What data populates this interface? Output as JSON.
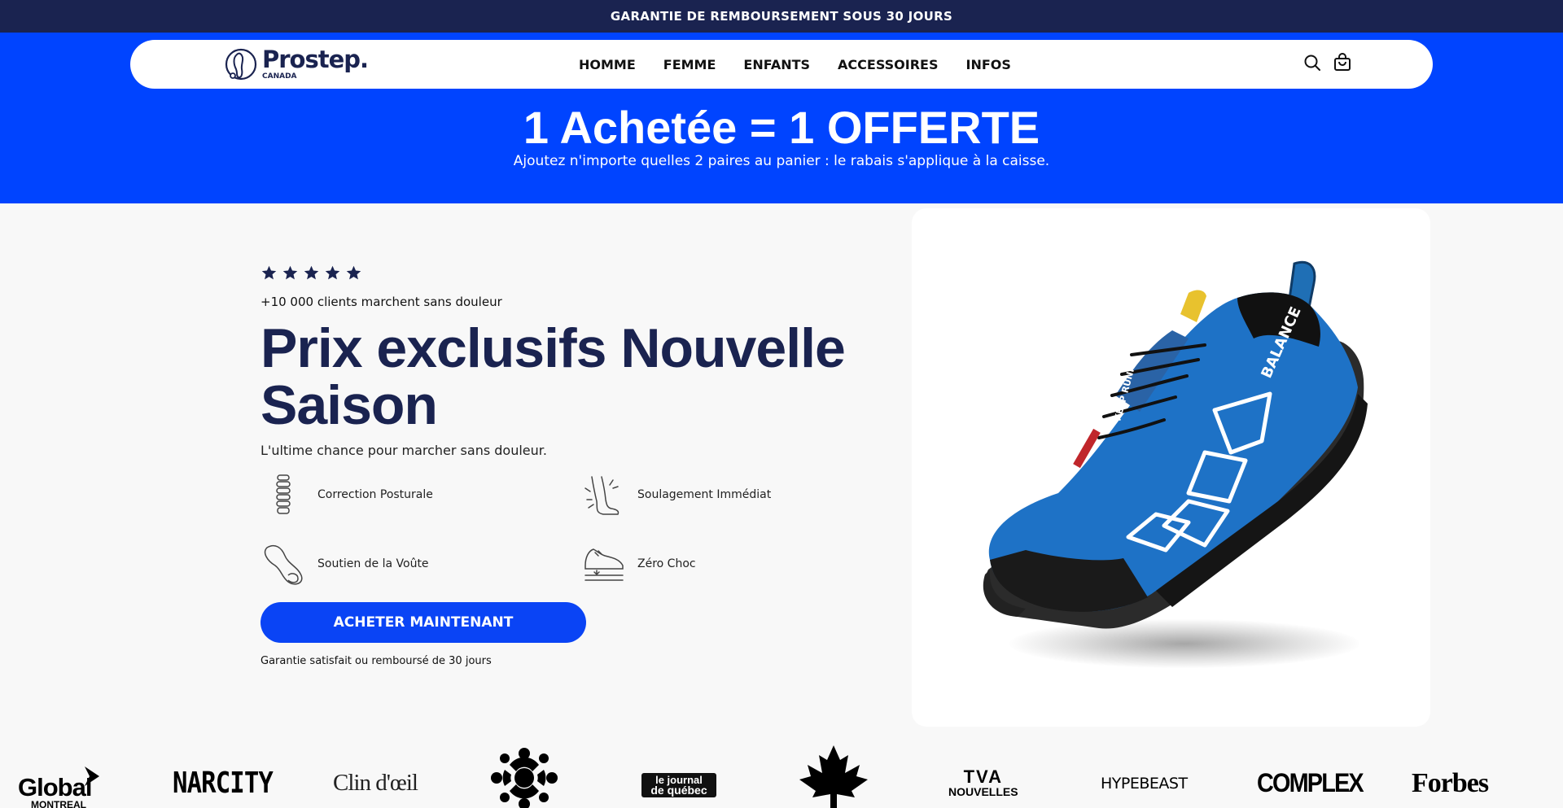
{
  "announcement": "GARANTIE DE REMBOURSEMENT SOUS 30 JOURS",
  "brand": {
    "name": "Prostep.",
    "sub": "CANADA"
  },
  "nav": {
    "links": [
      "HOMME",
      "FEMME",
      "ENFANTS",
      "ACCESSOIRES",
      "INFOS"
    ],
    "search_icon": "search-icon",
    "cart_icon": "cart-icon"
  },
  "promo": {
    "title": "1 Achetée = 1 OFFERTE",
    "subtitle": "Ajoutez n'importe quelles 2 paires au panier : le rabais s'applique à la caisse."
  },
  "hero": {
    "rating": 5,
    "clients": "+10 000 clients marchent sans douleur",
    "headline": "Prix exclusifs Nouvelle Saison",
    "tagline": "L'ultime chance pour marcher sans douleur.",
    "features": [
      {
        "label": "Correction Posturale",
        "icon": "spine-icon"
      },
      {
        "label": "Soulagement Immédiat",
        "icon": "foot-relief-icon"
      },
      {
        "label": "Soutien de la Voûte",
        "icon": "insole-icon"
      },
      {
        "label": "Zéro Choc",
        "icon": "shoe-cushion-icon"
      }
    ],
    "cta": "ACHETER MAINTENANT",
    "guarantee": "Garantie satisfait ou remboursé de 30 jours"
  },
  "product": {
    "image": "blue-trail-running-shoe",
    "side_text": "BALANCE",
    "tongue_text": "KEEP RUNN"
  },
  "press": {
    "global_main": "Global",
    "global_sub": "MONTREAL",
    "narcity": "NARCITY",
    "clindoeil": "Clin d'œil",
    "radio_canada": "radio-canada-logo",
    "journal_top": "le journal",
    "journal_bottom": "de québec",
    "maple": "maple-leaf-logo",
    "tva_main": "TVA",
    "tva_sub": "NOUVELLES",
    "hypebeast": "HYPEBEAST",
    "complex": "COMPLEX",
    "forbes": "Forbes"
  },
  "colors": {
    "navy": "#1a2350",
    "blue": "#0044ff",
    "cta": "#0a44f5"
  }
}
